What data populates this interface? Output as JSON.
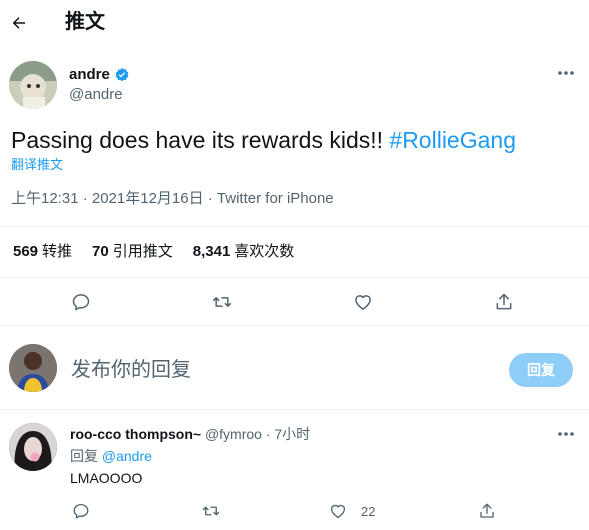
{
  "header": {
    "title": "推文"
  },
  "author": {
    "name": "andre",
    "handle": "@andre"
  },
  "tweet": {
    "text": "Passing does have its rewards kids!! ",
    "hashtag": "#RollieGang",
    "translate_label": "翻译推文",
    "timestamp": "上午12:31 · 2021年12月16日 · Twitter for iPhone"
  },
  "stats": [
    {
      "count": "569",
      "label": "转推"
    },
    {
      "count": "70",
      "label": "引用推文"
    },
    {
      "count": "8,341",
      "label": "喜欢次数"
    }
  ],
  "composer": {
    "placeholder": "发布你的回复",
    "reply_button": "回复"
  },
  "reply": {
    "name": "roo-cco thompson~",
    "handle": "@fymroo",
    "time": " · 7小时",
    "replying_prefix": "回复 ",
    "replying_to": "@andre",
    "text": "LMAOOOO",
    "like_count": "22"
  },
  "colors": {
    "accent": "#1d9bf0",
    "verified": "#1d9bf0",
    "reply_button_disabled": "#8ecdf7"
  },
  "icons": [
    "back-arrow-icon",
    "verified-badge-icon",
    "more-icon",
    "reply-icon",
    "retweet-icon",
    "like-icon",
    "share-icon"
  ]
}
